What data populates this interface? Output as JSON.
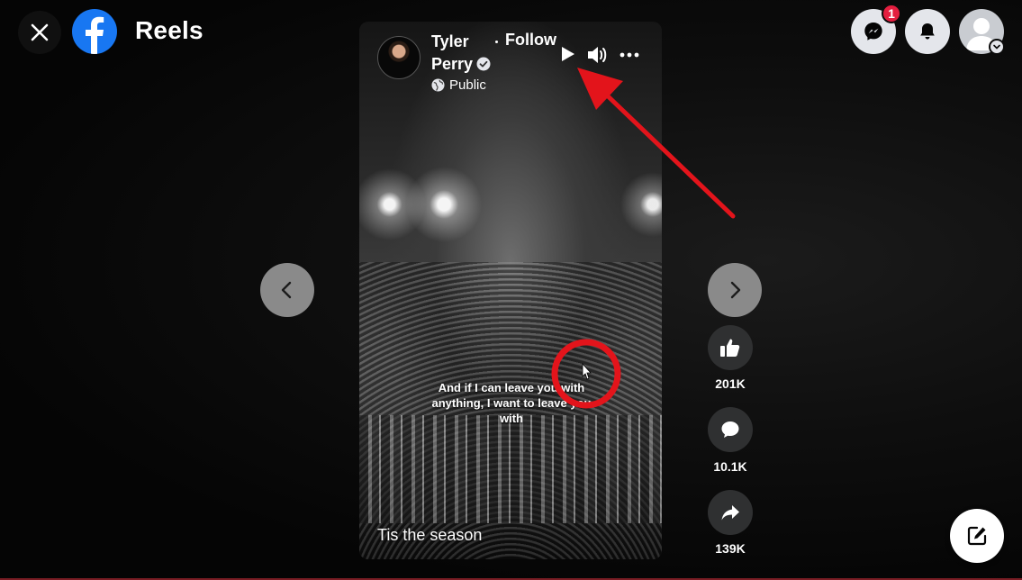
{
  "header": {
    "title": "Reels",
    "messenger_badge": "1"
  },
  "reel": {
    "author_first": "Tyler",
    "author_last": "Perry",
    "follow_label": "Follow",
    "privacy_label": "Public",
    "subtitle": "And if I can leave you with anything, I want to leave you with",
    "caption": "Tis the season"
  },
  "actions": {
    "likes": "201K",
    "comments": "10.1K",
    "shares": "139K"
  },
  "icons": {
    "close": "close-icon",
    "logo": "facebook-logo-icon",
    "messenger": "messenger-icon",
    "notifications": "bell-icon",
    "profile": "profile-avatar-icon",
    "play": "play-icon",
    "volume": "volume-icon",
    "more": "more-icon",
    "prev": "chevron-left-icon",
    "next": "chevron-right-icon",
    "like": "thumbs-up-icon",
    "comment": "comment-icon",
    "share": "share-icon",
    "compose": "compose-icon"
  },
  "colors": {
    "brand": "#1877f2",
    "badge": "#e41e3f",
    "annotation": "#e3141b"
  }
}
